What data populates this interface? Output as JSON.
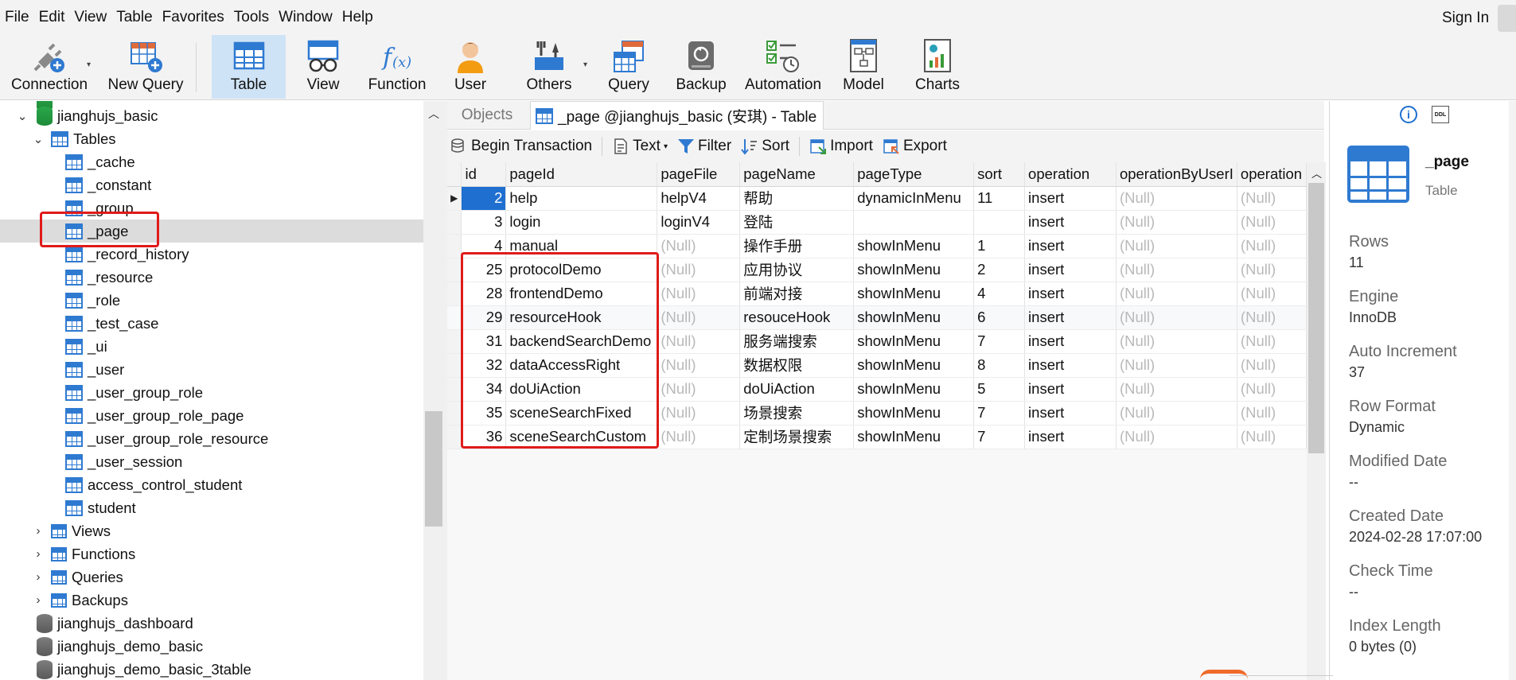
{
  "menu": [
    "File",
    "Edit",
    "View",
    "Table",
    "Favorites",
    "Tools",
    "Window",
    "Help"
  ],
  "signin": "Sign In",
  "toolbar": {
    "connection": "Connection",
    "new_query": "New Query",
    "table": "Table",
    "view": "View",
    "function": "Function",
    "user": "User",
    "others": "Others",
    "query": "Query",
    "backup": "Backup",
    "automation": "Automation",
    "model": "Model",
    "charts": "Charts"
  },
  "tree": {
    "database": "jianghujs_basic",
    "tables_label": "Tables",
    "tables": [
      "_cache",
      "_constant",
      "_group",
      "_page",
      "_record_history",
      "_resource",
      "_role",
      "_test_case",
      "_ui",
      "_user",
      "_user_group_role",
      "_user_group_role_page",
      "_user_group_role_resource",
      "_user_session",
      "access_control_student",
      "student"
    ],
    "groups": [
      "Views",
      "Functions",
      "Queries",
      "Backups"
    ],
    "other_dbs": [
      "jianghujs_dashboard",
      "jianghujs_demo_basic",
      "jianghujs_demo_basic_3table"
    ]
  },
  "tabs": {
    "objects": "Objects",
    "active": "_page @jianghujs_basic (安琪) - Table"
  },
  "actions": {
    "begin_transaction": "Begin Transaction",
    "text": "Text",
    "filter": "Filter",
    "sort": "Sort",
    "import": "Import",
    "export": "Export"
  },
  "grid": {
    "columns": [
      "id",
      "pageId",
      "pageFile",
      "pageName",
      "pageType",
      "sort",
      "operation",
      "operationByUserI",
      "operation"
    ],
    "rows": [
      [
        "2",
        "help",
        "helpV4",
        "帮助",
        "dynamicInMenu",
        "11",
        "insert",
        "(Null)",
        "(Null)"
      ],
      [
        "3",
        "login",
        "loginV4",
        "登陆",
        "",
        "",
        "insert",
        "(Null)",
        "(Null)"
      ],
      [
        "4",
        "manual",
        "(Null)",
        "操作手册",
        "showInMenu",
        "1",
        "insert",
        "(Null)",
        "(Null)"
      ],
      [
        "25",
        "protocolDemo",
        "(Null)",
        "应用协议",
        "showInMenu",
        "2",
        "insert",
        "(Null)",
        "(Null)"
      ],
      [
        "28",
        "frontendDemo",
        "(Null)",
        "前端对接",
        "showInMenu",
        "4",
        "insert",
        "(Null)",
        "(Null)"
      ],
      [
        "29",
        "resourceHook",
        "(Null)",
        "resouceHook",
        "showInMenu",
        "6",
        "insert",
        "(Null)",
        "(Null)"
      ],
      [
        "31",
        "backendSearchDemo",
        "(Null)",
        "服务端搜索",
        "showInMenu",
        "7",
        "insert",
        "(Null)",
        "(Null)"
      ],
      [
        "32",
        "dataAccessRight",
        "(Null)",
        "数据权限",
        "showInMenu",
        "8",
        "insert",
        "(Null)",
        "(Null)"
      ],
      [
        "34",
        "doUiAction",
        "(Null)",
        "doUiAction",
        "showInMenu",
        "5",
        "insert",
        "(Null)",
        "(Null)"
      ],
      [
        "35",
        "sceneSearchFixed",
        "(Null)",
        "场景搜索",
        "showInMenu",
        "7",
        "insert",
        "(Null)",
        "(Null)"
      ],
      [
        "36",
        "sceneSearchCustom",
        "(Null)",
        "定制场景搜索",
        "showInMenu",
        "7",
        "insert",
        "(Null)",
        "(Null)"
      ]
    ]
  },
  "info": {
    "name": "_page",
    "kind": "Table",
    "ddl_icon_text": "DDL",
    "props": [
      {
        "k": "Rows",
        "v": "11"
      },
      {
        "k": "Engine",
        "v": "InnoDB"
      },
      {
        "k": "Auto Increment",
        "v": "37"
      },
      {
        "k": "Row Format",
        "v": "Dynamic"
      },
      {
        "k": "Modified Date",
        "v": "--"
      },
      {
        "k": "Created Date",
        "v": "2024-02-28 17:07:00"
      },
      {
        "k": "Check Time",
        "v": "--"
      },
      {
        "k": "Index Length",
        "v": "0 bytes (0)"
      }
    ]
  },
  "colors": {
    "accent": "#1e6fd0",
    "highlight_box": "#e01a1a",
    "null_text": "#b9b9b9"
  }
}
